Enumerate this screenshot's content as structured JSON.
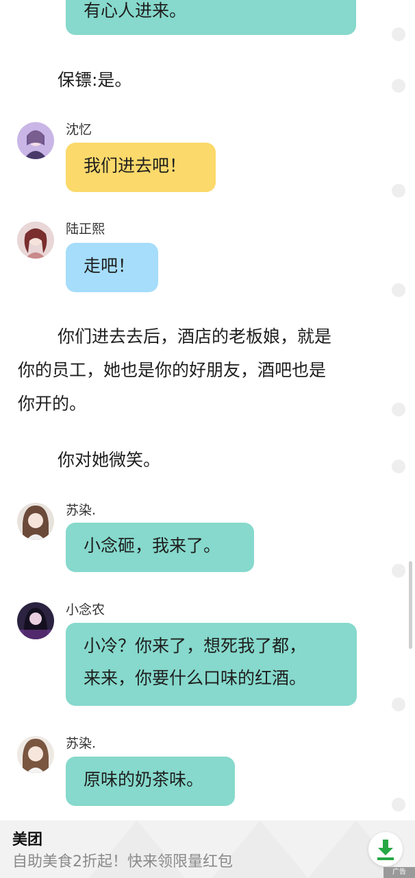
{
  "story": {
    "bubble_top": "有心人进来。",
    "narration_1": "保镖:是。",
    "msg_1": {
      "name": "沈忆",
      "text": "我们进去吧！"
    },
    "msg_2": {
      "name": "陆正熙",
      "text": "走吧！"
    },
    "narration_2_line1": "你们进去去后，酒店的老板娘，就是",
    "narration_2_line2": "你的员工，她也是你的好朋友，酒吧也是",
    "narration_2_line3": "你开的。",
    "narration_3": "你对她微笑。",
    "msg_3": {
      "name": "苏染.",
      "text": "小念砸，我来了。"
    },
    "msg_4": {
      "name": "小念农",
      "line1": "小冷？你来了，想死我了都，",
      "line2": "来来，你要什么口味的红酒。"
    },
    "msg_5": {
      "name": "苏染.",
      "text": "原味的奶茶味。"
    }
  },
  "ad": {
    "title": "美团",
    "subtitle": "自助美食2折起！快来领限量红包",
    "tag": "广告",
    "download_icon": "download-icon"
  },
  "colors": {
    "teal_bubble": "#86d9cc",
    "yellow_bubble": "#fbd96b",
    "blue_bubble": "#a6ddfb"
  }
}
